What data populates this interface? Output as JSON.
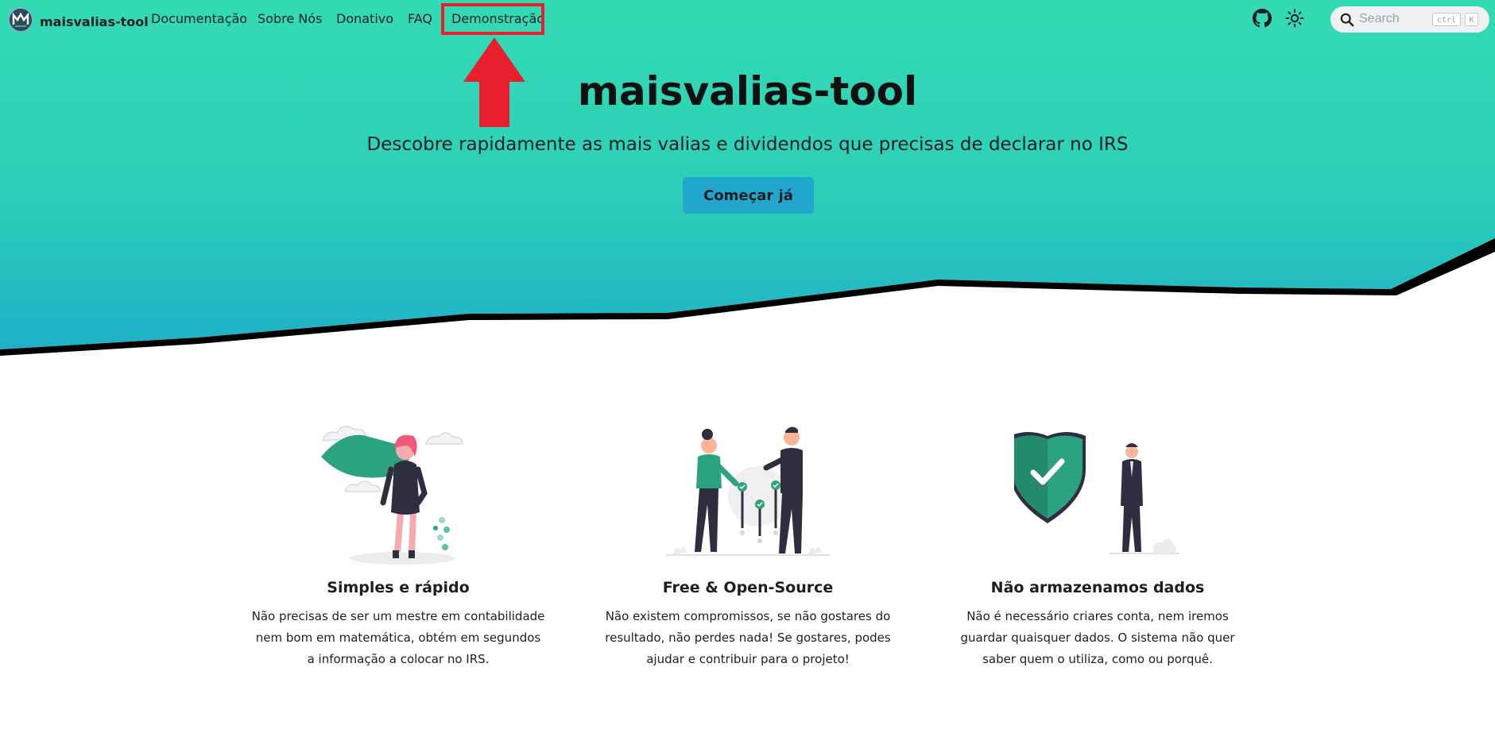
{
  "nav": {
    "brand": "maisvalias-tool",
    "links": [
      "Documentação",
      "Sobre Nós",
      "Donativo",
      "FAQ",
      "Demonstração"
    ],
    "icons": {
      "github": "github-icon",
      "theme": "sun-icon",
      "logo": "logo-icon"
    }
  },
  "search": {
    "placeholder": "Search",
    "shortcut_ctrl": "ctrl",
    "shortcut_key": "K"
  },
  "hero": {
    "title": "maisvalias-tool",
    "subtitle": "Descobre rapidamente as mais valias e dividendos que precisas de declarar no IRS",
    "cta": "Começar já"
  },
  "features": [
    {
      "title": "Simples e rápido",
      "text": "Não precisas de ser um mestre em contabilidade nem bom em matemática, obtém em segundos a informação a colocar no IRS."
    },
    {
      "title": "Free & Open-Source",
      "text": "Não existem compromissos, se não gostares do resultado, não perdes nada! Se gostares, podes ajudar e contribuir para o projeto!"
    },
    {
      "title": "Não armazenamos dados",
      "text": "Não é necessário criares conta, nem iremos guardar quaisquer dados. O sistema não quer saber quem o utiliza, como ou porquê."
    }
  ],
  "colors": {
    "hero_top": "#30d9b2",
    "hero_bottom": "#21b5c6",
    "cta": "#21a7ce",
    "highlight": "#e8202e",
    "illustration_accent": "#2ba381"
  }
}
